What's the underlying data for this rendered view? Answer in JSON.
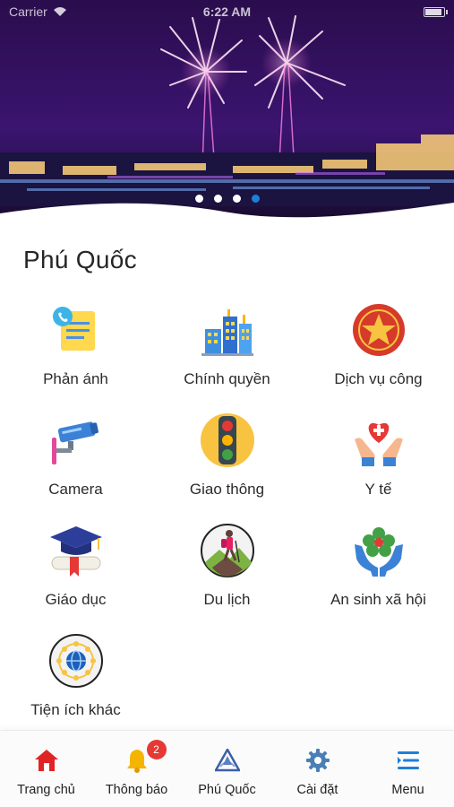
{
  "status_bar": {
    "carrier": "Carrier",
    "time": "6:22 AM"
  },
  "banner": {
    "slide_count": 4,
    "active_slide": 4
  },
  "page": {
    "title": "Phú Quốc"
  },
  "tiles": [
    {
      "label": "Phản ánh",
      "icon": "feedback-icon"
    },
    {
      "label": "Chính quyền",
      "icon": "government-buildings-icon"
    },
    {
      "label": "Dịch vụ công",
      "icon": "public-service-star-icon"
    },
    {
      "label": "Camera",
      "icon": "security-camera-icon"
    },
    {
      "label": "Giao thông",
      "icon": "traffic-light-icon"
    },
    {
      "label": "Y tế",
      "icon": "healthcare-hands-heart-icon"
    },
    {
      "label": "Giáo dục",
      "icon": "graduation-cap-icon"
    },
    {
      "label": "Du lịch",
      "icon": "hiker-icon"
    },
    {
      "label": "An sinh xã hội",
      "icon": "social-welfare-icon"
    },
    {
      "label": "Tiện ích khác",
      "icon": "globe-network-icon"
    }
  ],
  "tabbar": {
    "items": [
      {
        "label": "Trang chủ",
        "icon": "home-icon"
      },
      {
        "label": "Thông báo",
        "icon": "bell-icon",
        "badge": "2"
      },
      {
        "label": "Phú Quốc",
        "icon": "city-logo-icon"
      },
      {
        "label": "Cài đặt",
        "icon": "gear-icon"
      },
      {
        "label": "Menu",
        "icon": "menu-icon"
      }
    ]
  },
  "colors": {
    "accent": "#1e7fd8",
    "home_red": "#e02424",
    "badge_red": "#e53935",
    "bell_yellow": "#f5b400"
  }
}
